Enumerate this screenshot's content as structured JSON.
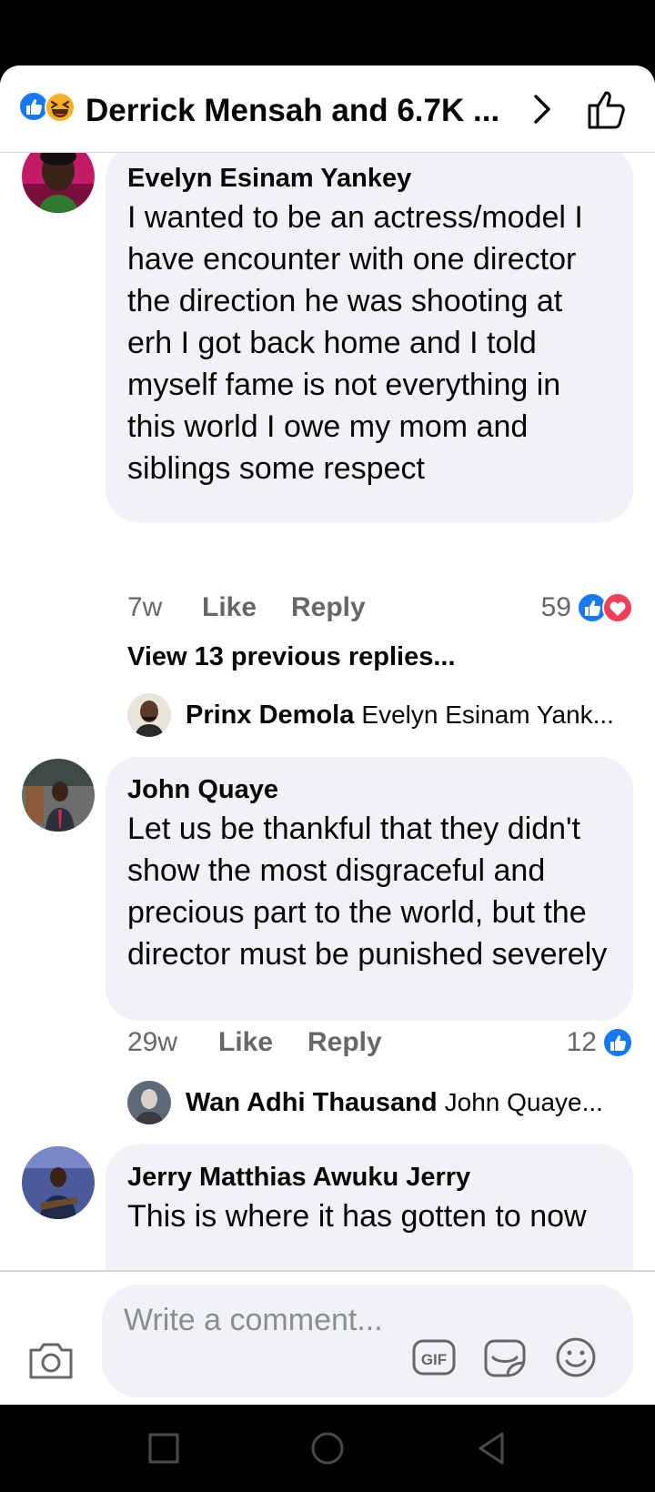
{
  "header": {
    "title": "Derrick Mensah and 6.7K ...",
    "reaction_icons": [
      "like-icon",
      "haha-icon"
    ],
    "forward_icon": "chevron-right-icon",
    "like_button_icon": "thumbs-up-outline-icon"
  },
  "comments": [
    {
      "author": "Evelyn Esinam Yankey",
      "text": "I wanted to be an actress/model I have encounter with one director the direction he was shooting at erh I got back home and I told myself fame is not everything in this world I owe my mom and siblings some respect",
      "time": "7w",
      "like_label": "Like",
      "reply_label": "Reply",
      "reaction_count": "59",
      "reactions": [
        "like-icon",
        "love-icon"
      ],
      "view_previous": "View 13 previous replies...",
      "reply_preview": {
        "author": "Prinx Demola",
        "text": "Evelyn Esinam Yank..."
      }
    },
    {
      "author": "John Quaye",
      "text": "Let us be thankful that they didn't show the most disgraceful and precious part to the world, but the director must be punished severely",
      "time": "29w",
      "like_label": "Like",
      "reply_label": "Reply",
      "reaction_count": "12",
      "reactions": [
        "like-icon"
      ],
      "reply_preview": {
        "author": "Wan Adhi Thausand",
        "text": "John Quaye..."
      }
    },
    {
      "author": "Jerry Matthias Awuku Jerry",
      "text": "This is where it has gotten to now"
    }
  ],
  "composer": {
    "placeholder": "Write a comment...",
    "icons": [
      "camera-icon",
      "gif-icon",
      "sticker-icon",
      "emoji-icon"
    ]
  },
  "colors": {
    "accent": "#1877f2",
    "love": "#f33e58",
    "haha": "#f7b125",
    "bubble": "#f0f2f5",
    "secondary_text": "#65676b"
  }
}
